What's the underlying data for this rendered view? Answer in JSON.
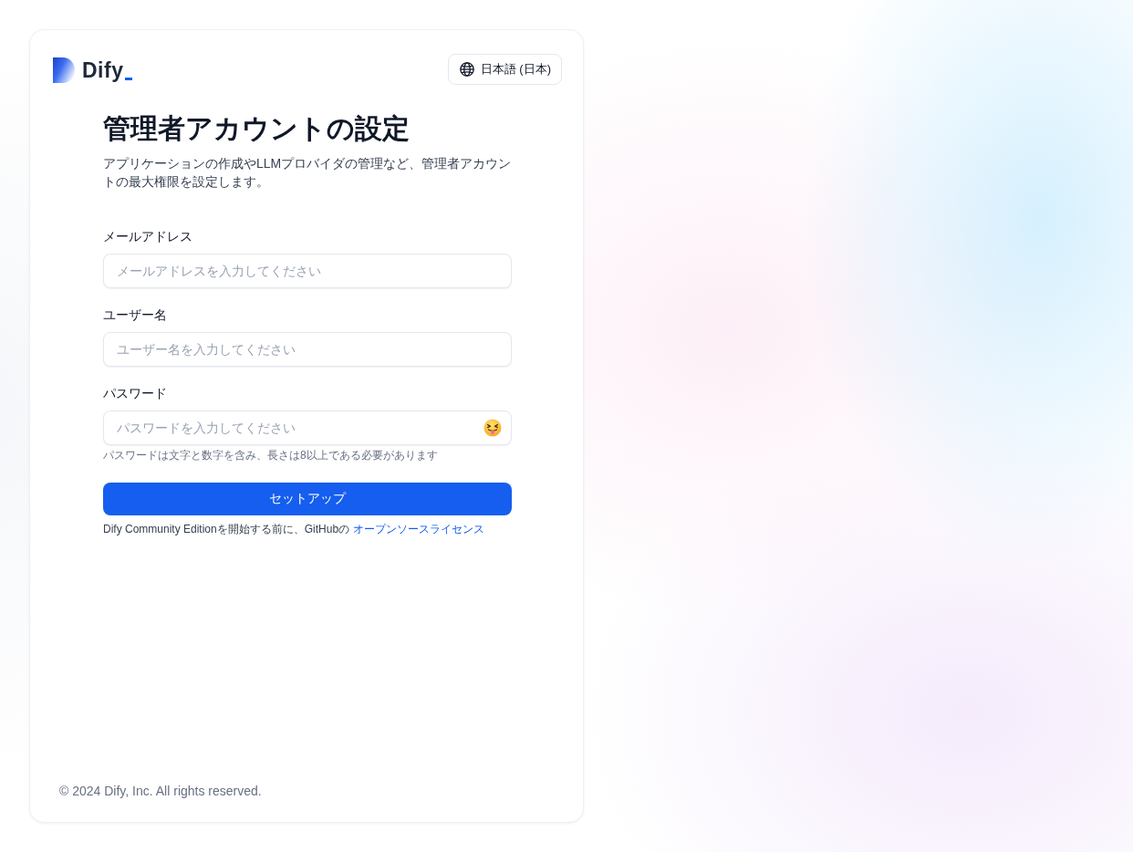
{
  "header": {
    "logo_text": "Dify",
    "language_button": "日本語 (日本)"
  },
  "title": "管理者アカウントの設定",
  "description": "アプリケーションの作成やLLMプロバイダの管理など、管理者アカウントの最大権限を設定します。",
  "form": {
    "fields": [
      {
        "kind": "email",
        "label": "メールアドレス",
        "placeholder": "メールアドレスを入力してください"
      },
      {
        "kind": "text",
        "label": "ユーザー名",
        "placeholder": "ユーザー名を入力してください"
      },
      {
        "kind": "password",
        "label": "パスワード",
        "placeholder": "パスワードを入力してください",
        "hint": "パスワードは文字と数字を含み、長さは8以上である必要があります"
      }
    ],
    "submit_button": "セットアップ",
    "license_notice": {
      "text": "Dify Community Editionを開始する前に、GitHubの",
      "link": "オープンソースライセンス"
    }
  },
  "footer": "© 2024 Dify, Inc. All rights reserved."
}
